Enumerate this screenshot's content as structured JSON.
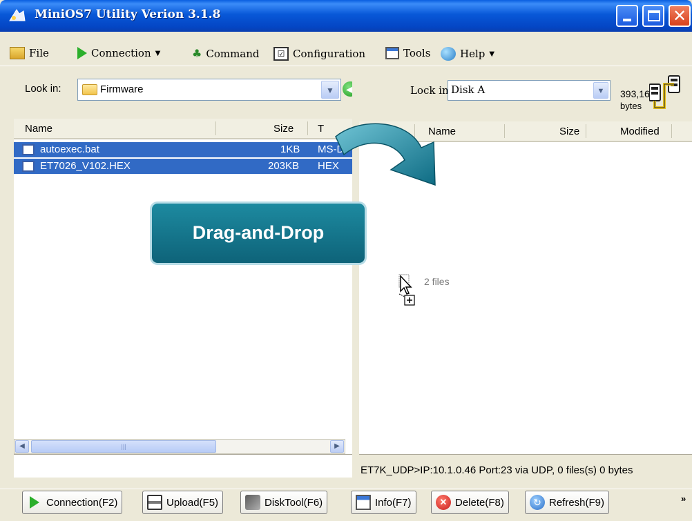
{
  "window": {
    "title": "MiniOS7 Utility Verion 3.1.8"
  },
  "menu": {
    "file": "File",
    "connection": "Connection",
    "command": "Command",
    "configuration": "Configuration",
    "tools": "Tools",
    "help": "Help"
  },
  "left_pane": {
    "look_in_label": "Look in:",
    "look_in_value": "Firmware",
    "columns": [
      "Name",
      "Size",
      "T"
    ],
    "files": [
      {
        "name": "autoexec.bat",
        "size": "1KB",
        "type": "MS-D"
      },
      {
        "name": "ET7026_V102.HEX",
        "size": "203KB",
        "type": "HEX"
      }
    ]
  },
  "right_pane": {
    "lock_in_label": "Lock in:",
    "lock_in_value": "Disk A",
    "free_bytes": "393,16",
    "bytes_label": "bytes",
    "columns": [
      "Name",
      "Size",
      "Modified"
    ],
    "drag_ghost_text": "2 files",
    "status": "ET7K_UDP>IP:10.1.0.46 Port:23 via UDP, 0 files(s) 0 bytes"
  },
  "toolbar": {
    "buttons": [
      "Connection(F2)",
      "Upload(F5)",
      "DiskTool(F6)",
      "Info(F7)",
      "Delete(F8)",
      "Refresh(F9)"
    ],
    "more": "»"
  },
  "overlay": {
    "label": "Drag-and-Drop"
  },
  "colors": {
    "selection": "#316AC5",
    "overlay": "#137A90",
    "titlebar": "#0A5FE0"
  }
}
